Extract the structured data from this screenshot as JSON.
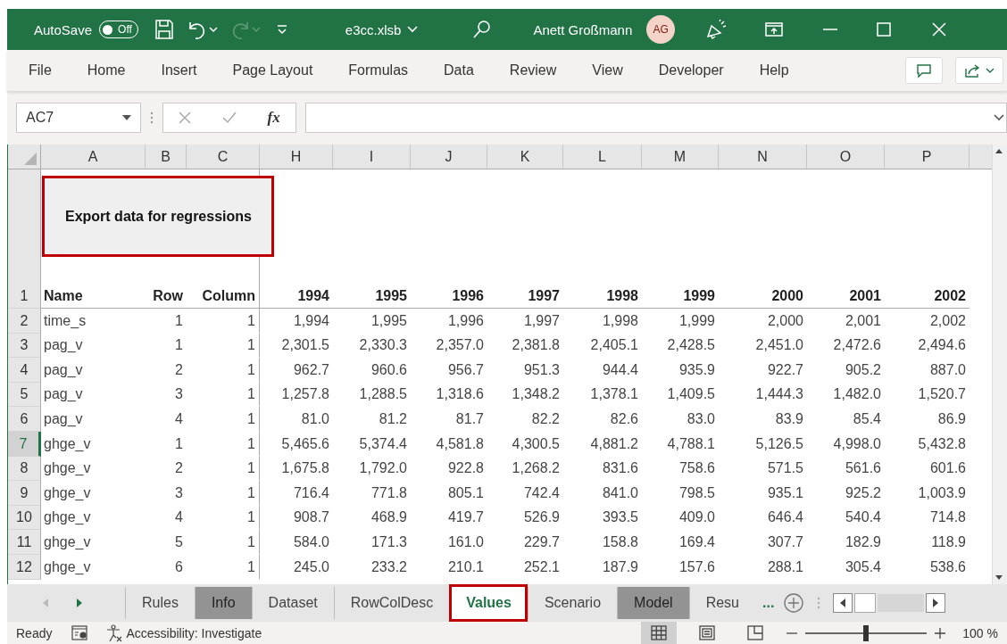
{
  "title_bar": {
    "autosave_label": "AutoSave",
    "autosave": {
      "on": false,
      "label": "Off"
    },
    "filename": "e3cc.xlsb",
    "user_name": "Anett Großmann",
    "avatar_initials": "AG"
  },
  "ribbon_tabs": [
    "File",
    "Home",
    "Insert",
    "Page Layout",
    "Formulas",
    "Data",
    "Review",
    "View",
    "Developer",
    "Help"
  ],
  "formula_bar": {
    "name_box": "AC7",
    "function_label": "fx"
  },
  "sheet": {
    "columns": [
      "A",
      "B",
      "C",
      "H",
      "I",
      "J",
      "K",
      "L",
      "M",
      "N",
      "O",
      "P"
    ],
    "title_box": {
      "text": "Export data for regressions",
      "highlighted": true
    },
    "header_row": {
      "number": "1",
      "cells": [
        "Name",
        "Row",
        "Column",
        "1994",
        "1995",
        "1996",
        "1997",
        "1998",
        "1999",
        "2000",
        "2001",
        "2002"
      ]
    },
    "rows": [
      {
        "number": "2",
        "selected": false,
        "cells": [
          "time_s",
          "1",
          "1",
          "1,994",
          "1,995",
          "1,996",
          "1,997",
          "1,998",
          "1,999",
          "2,000",
          "2,001",
          "2,002"
        ]
      },
      {
        "number": "3",
        "selected": false,
        "cells": [
          "pag_v",
          "1",
          "1",
          "2,301.5",
          "2,330.3",
          "2,357.0",
          "2,381.8",
          "2,405.1",
          "2,428.5",
          "2,451.0",
          "2,472.6",
          "2,494.6"
        ]
      },
      {
        "number": "4",
        "selected": false,
        "cells": [
          "pag_v",
          "2",
          "1",
          "962.7",
          "960.6",
          "956.7",
          "951.3",
          "944.4",
          "935.9",
          "922.7",
          "905.2",
          "887.0"
        ]
      },
      {
        "number": "5",
        "selected": false,
        "cells": [
          "pag_v",
          "3",
          "1",
          "1,257.8",
          "1,288.5",
          "1,318.6",
          "1,348.2",
          "1,378.1",
          "1,409.5",
          "1,444.3",
          "1,482.0",
          "1,520.7"
        ]
      },
      {
        "number": "6",
        "selected": false,
        "cells": [
          "pag_v",
          "4",
          "1",
          "81.0",
          "81.2",
          "81.7",
          "82.2",
          "82.6",
          "83.0",
          "83.9",
          "85.4",
          "86.9"
        ]
      },
      {
        "number": "7",
        "selected": true,
        "cells": [
          "ghge_v",
          "1",
          "1",
          "5,465.6",
          "5,374.4",
          "4,581.8",
          "4,300.5",
          "4,881.2",
          "4,788.1",
          "5,126.5",
          "4,998.0",
          "5,432.8"
        ]
      },
      {
        "number": "8",
        "selected": false,
        "cells": [
          "ghge_v",
          "2",
          "1",
          "1,675.8",
          "1,792.0",
          "922.8",
          "1,268.2",
          "831.6",
          "758.6",
          "571.5",
          "561.6",
          "601.6"
        ]
      },
      {
        "number": "9",
        "selected": false,
        "cells": [
          "ghge_v",
          "3",
          "1",
          "716.4",
          "771.8",
          "805.1",
          "742.4",
          "841.0",
          "798.5",
          "935.1",
          "925.2",
          "1,003.9"
        ]
      },
      {
        "number": "10",
        "selected": false,
        "cells": [
          "ghge_v",
          "4",
          "1",
          "908.7",
          "468.9",
          "419.7",
          "526.9",
          "393.5",
          "409.0",
          "646.4",
          "540.4",
          "714.8"
        ]
      },
      {
        "number": "11",
        "selected": false,
        "cells": [
          "ghge_v",
          "5",
          "1",
          "584.0",
          "171.3",
          "161.0",
          "229.7",
          "158.8",
          "169.4",
          "307.7",
          "182.9",
          "118.9"
        ]
      },
      {
        "number": "12",
        "selected": false,
        "cells": [
          "ghge_v",
          "6",
          "1",
          "245.0",
          "233.2",
          "210.1",
          "252.1",
          "187.9",
          "157.6",
          "288.1",
          "305.4",
          "538.6"
        ]
      }
    ]
  },
  "sheet_tabs": [
    {
      "label": "Rules",
      "selected": false,
      "highlighted": false
    },
    {
      "label": "Info",
      "selected": false,
      "highlighted": false,
      "color": "#939393"
    },
    {
      "label": "Dataset",
      "selected": false,
      "highlighted": false
    },
    {
      "label": "RowColDesc",
      "selected": false,
      "highlighted": false
    },
    {
      "label": "Values",
      "selected": true,
      "highlighted": true
    },
    {
      "label": "Scenario",
      "selected": false,
      "highlighted": false
    },
    {
      "label": "Model",
      "selected": false,
      "highlighted": false,
      "color": "#939393"
    },
    {
      "label": "Resu",
      "selected": false,
      "highlighted": false
    }
  ],
  "more_tabs": "...",
  "status_bar": {
    "ready": "Ready",
    "accessibility": "Accessibility: Investigate",
    "views": [
      {
        "kind": "normal",
        "selected": true
      },
      {
        "kind": "page-layout",
        "selected": false
      },
      {
        "kind": "page-break",
        "selected": false
      }
    ],
    "zoom": {
      "level": 0.5,
      "label": "100 %"
    }
  }
}
